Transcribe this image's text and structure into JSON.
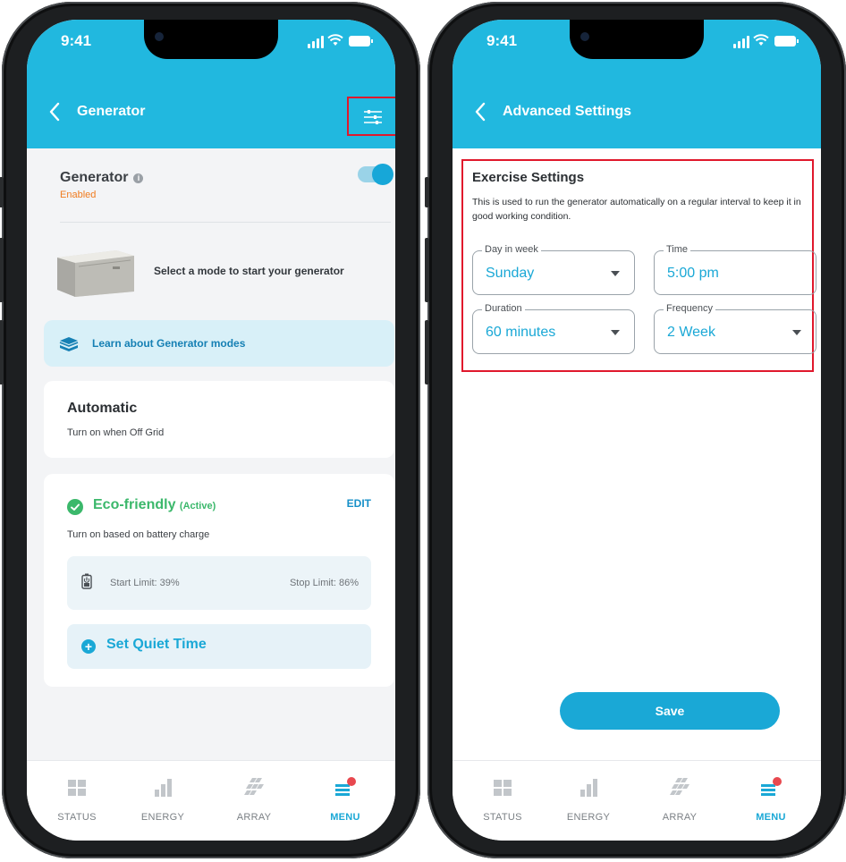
{
  "colors": {
    "brand": "#21b8df",
    "accent": "#1aa8d6",
    "highlight_box": "#e0182c",
    "eco_green": "#3bb86b",
    "enabled_orange": "#f07b1e"
  },
  "status_bar": {
    "time": "9:41"
  },
  "tabs": [
    {
      "label": "STATUS",
      "icon": "status-grid-icon"
    },
    {
      "label": "ENERGY",
      "icon": "energy-bars-icon"
    },
    {
      "label": "ARRAY",
      "icon": "solar-array-icon"
    },
    {
      "label": "MENU",
      "icon": "menu-icon",
      "active": true
    }
  ],
  "generator_screen": {
    "title": "Generator",
    "section_title": "Generator",
    "status": "Enabled",
    "toggle_on": true,
    "prompt": "Select a mode to start your generator",
    "learn_link": "Learn about Generator modes",
    "automatic": {
      "title": "Automatic",
      "subtitle": "Turn on when Off Grid"
    },
    "eco": {
      "title": "Eco-friendly",
      "state": "(Active)",
      "edit_label": "EDIT",
      "subtitle": "Turn on based on battery charge",
      "start_limit": "Start Limit: 39%",
      "stop_limit": "Stop Limit: 86%",
      "quiet_time_label": "Set Quiet Time"
    }
  },
  "advanced_screen": {
    "title": "Advanced Settings",
    "section_title": "Exercise Settings",
    "description": "This is used to run the generator automatically on a regular interval to keep it in good working condition.",
    "fields": {
      "day": {
        "label": "Day in week",
        "value": "Sunday"
      },
      "time": {
        "label": "Time",
        "value": "5:00 pm"
      },
      "duration": {
        "label": "Duration",
        "value": "60 minutes"
      },
      "frequency": {
        "label": "Frequency",
        "value": "2 Week"
      }
    },
    "save_label": "Save"
  }
}
